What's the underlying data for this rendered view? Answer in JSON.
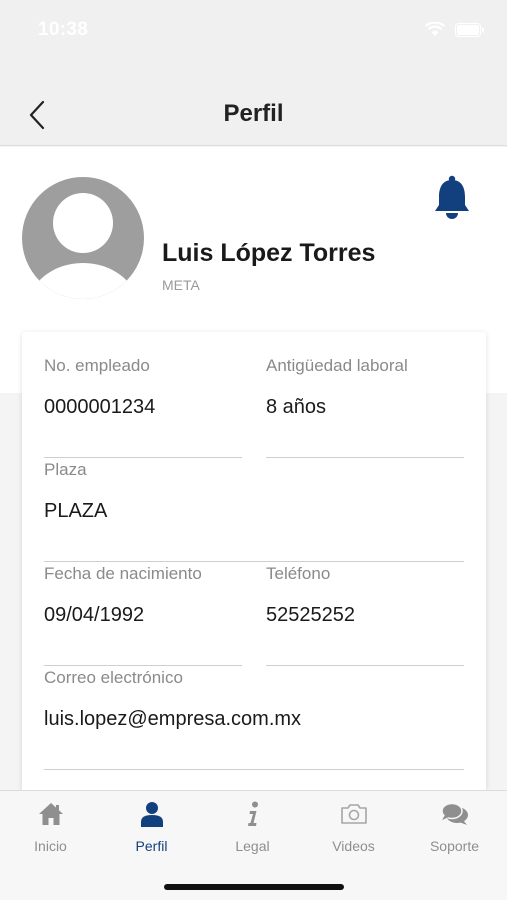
{
  "status_bar": {
    "time": "10:38"
  },
  "nav": {
    "title": "Perfil"
  },
  "profile": {
    "name": "Luis López Torres",
    "role": "META"
  },
  "fields": {
    "employee_no": {
      "label": "No. empleado",
      "value": "0000001234"
    },
    "seniority": {
      "label": "Antigüedad laboral",
      "value": "8 años"
    },
    "plaza": {
      "label": "Plaza",
      "value": "PLAZA"
    },
    "birthdate": {
      "label": "Fecha de nacimiento",
      "value": "09/04/1992"
    },
    "phone": {
      "label": "Teléfono",
      "value": "52525252"
    },
    "email": {
      "label": "Correo electrónico",
      "value": "luis.lopez@empresa.com.mx"
    }
  },
  "tabs": [
    {
      "label": "Inicio",
      "icon": "home-icon"
    },
    {
      "label": "Perfil",
      "icon": "user-icon",
      "active": true
    },
    {
      "label": "Legal",
      "icon": "info-icon"
    },
    {
      "label": "Videos",
      "icon": "camera-icon"
    },
    {
      "label": "Soporte",
      "icon": "chat-icon"
    }
  ],
  "colors": {
    "accent": "#12407f",
    "inactive": "#8f8f8f",
    "background": "#f4f4f4"
  }
}
